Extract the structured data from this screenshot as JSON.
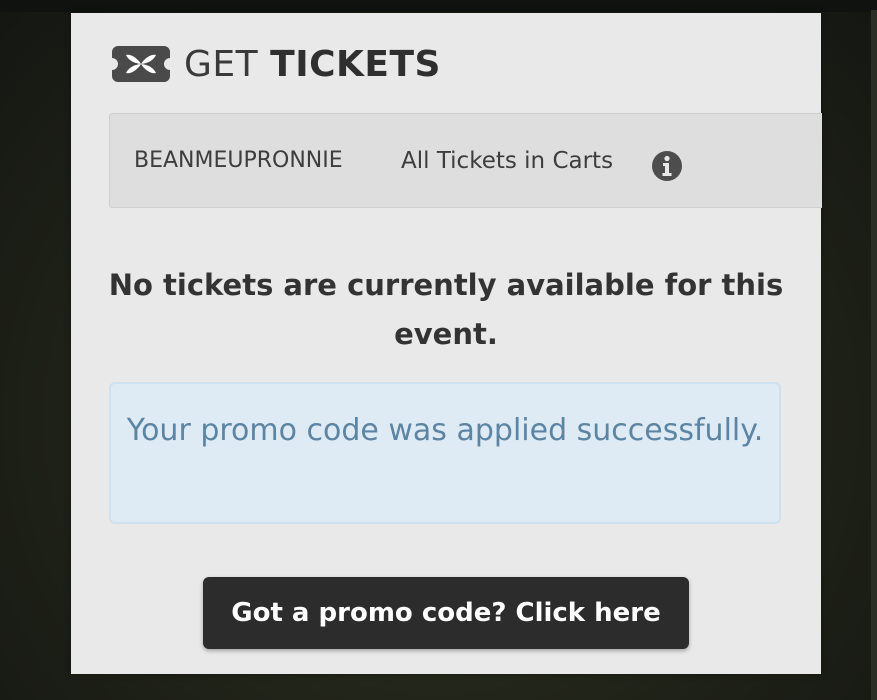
{
  "header": {
    "title_light": "GET",
    "title_bold": "TICKETS",
    "icon": "ticket-icon"
  },
  "tabs": {
    "user_label": "BEANMEUPRONNIE",
    "carts_label": "All Tickets in Carts",
    "info_icon": "info-icon"
  },
  "main": {
    "no_tickets_message": "No tickets are currently available for this event."
  },
  "alert": {
    "message": "Your promo code was applied successfully."
  },
  "promo": {
    "button_label": "Got a promo code? Click here"
  },
  "colors": {
    "panel_bg": "#e9e9e9",
    "alert_bg": "#dfebf4",
    "alert_text": "#5c84a3",
    "button_bg": "#2c2c2c"
  }
}
